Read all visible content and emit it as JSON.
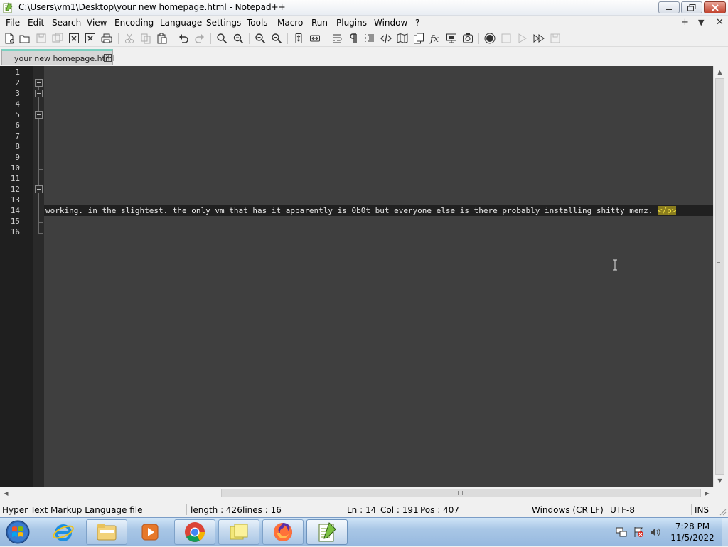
{
  "window": {
    "title": "C:\\Users\\vm1\\Desktop\\your new homepage.html - Notepad++"
  },
  "menu": [
    "File",
    "Edit",
    "Search",
    "View",
    "Encoding",
    "Language",
    "Settings",
    "Tools",
    "Macro",
    "Run",
    "Plugins",
    "Window",
    "?"
  ],
  "menu_right": {
    "add": "+",
    "dropdown": "▼",
    "close": "✕"
  },
  "toolbar_icons": [
    "new-file-icon",
    "open-file-icon",
    "save-icon",
    "save-all-icon",
    "close-icon",
    "close-all-icon",
    "print-icon",
    "cut-icon",
    "copy-icon",
    "paste-icon",
    "undo-icon",
    "redo-icon",
    "find-icon",
    "replace-icon",
    "zoom-in-icon",
    "zoom-out-icon",
    "sync-vertical-icon",
    "sync-horizontal-icon",
    "word-wrap-icon",
    "show-all-characters-icon",
    "indent-guide-icon",
    "user-defined-language-icon",
    "document-map-icon",
    "document-list-icon",
    "function-list-icon",
    "folder-as-workspace-icon",
    "monitoring-icon",
    "record-macro-icon",
    "stop-recording-icon",
    "playback-icon",
    "run-multiple-macro-icon",
    "save-macro-icon"
  ],
  "tab": {
    "label": "your new homepage.html",
    "close": "x"
  },
  "editor": {
    "line_numbers": [
      "1",
      "2",
      "3",
      "4",
      "5",
      "6",
      "7",
      "8",
      "9",
      "10",
      "11",
      "12",
      "13",
      "14",
      "15",
      "16"
    ],
    "current_line_text": "working. in the slightest. the only vm that has it apparently is 0b0t but everyone else is there probably installing shitty memz. ",
    "current_line_closing_tag": "</p>"
  },
  "status": {
    "file_type": "Hyper Text Markup Language file",
    "length": "length : 426",
    "lines": "lines : 16",
    "ln": "Ln : 14",
    "col": "Col : 191",
    "pos": "Pos : 407",
    "eol": "Windows (CR LF)",
    "encoding": "UTF-8",
    "mode": "INS"
  },
  "taskbar": {
    "apps": [
      "internet-explorer-icon",
      "windows-explorer-icon",
      "media-player-icon",
      "chrome-icon",
      "sticky-notes-icon",
      "firefox-icon",
      "notepad-plus-plus-icon"
    ],
    "time": "7:28 PM",
    "date": "11/5/2022"
  }
}
